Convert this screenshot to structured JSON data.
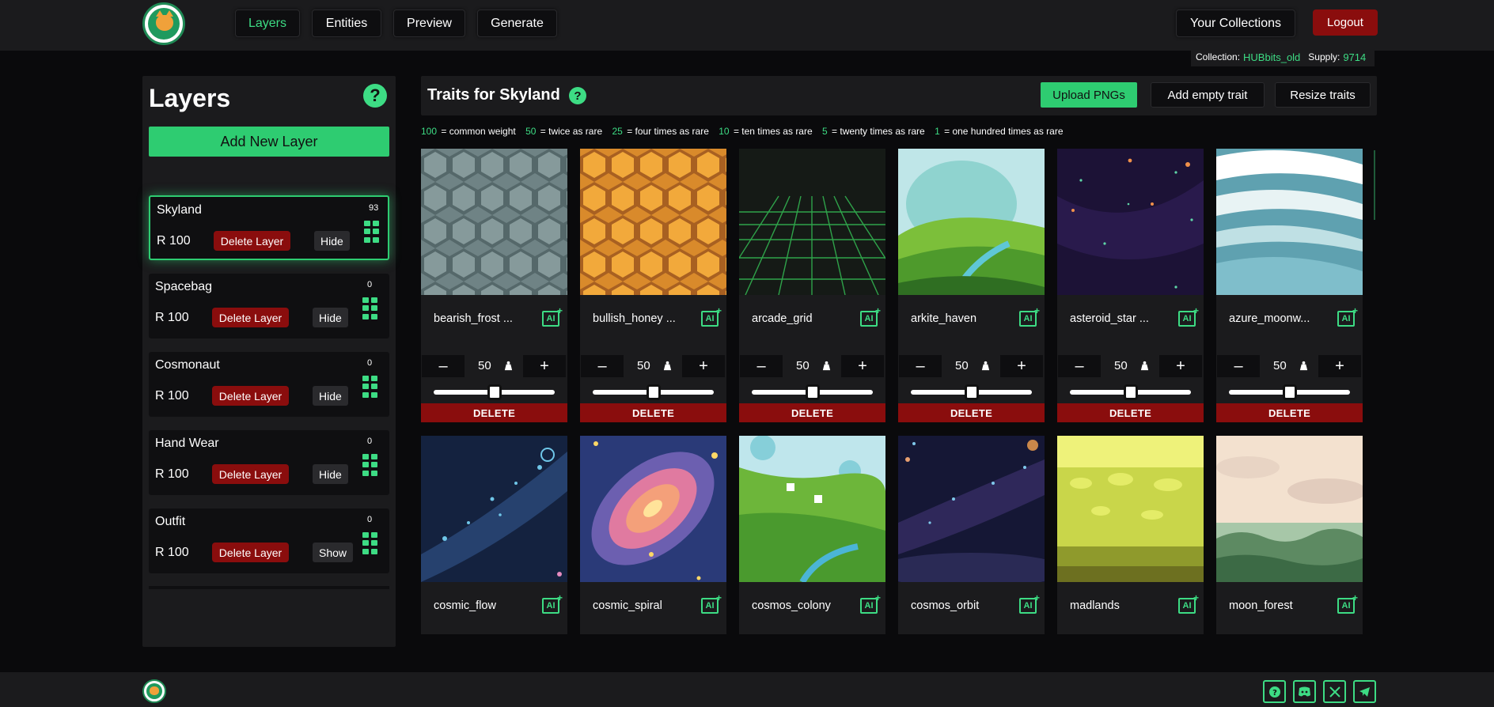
{
  "nav": {
    "tabs": [
      {
        "label": "Layers",
        "active": true
      },
      {
        "label": "Entities"
      },
      {
        "label": "Preview"
      },
      {
        "label": "Generate"
      }
    ],
    "collections_label": "Your Collections",
    "logout_label": "Logout"
  },
  "collection": {
    "collection_label": "Collection:",
    "collection_name": "HUBbits_old",
    "supply_label": "Supply:",
    "supply_value": "9714"
  },
  "layers": {
    "title": "Layers",
    "help_icon": "?",
    "add_label": "Add New Layer",
    "items": [
      {
        "name": "Skyland",
        "rarity": "R 100",
        "count": "93",
        "delete_label": "Delete Layer",
        "visibility_label": "Hide",
        "selected": true
      },
      {
        "name": "Spacebag",
        "rarity": "R 100",
        "count": "0",
        "delete_label": "Delete Layer",
        "visibility_label": "Hide"
      },
      {
        "name": "Cosmonaut",
        "rarity": "R 100",
        "count": "0",
        "delete_label": "Delete Layer",
        "visibility_label": "Hide"
      },
      {
        "name": "Hand Wear",
        "rarity": "R 100",
        "count": "0",
        "delete_label": "Delete Layer",
        "visibility_label": "Hide"
      },
      {
        "name": "Outfit",
        "rarity": "R 100",
        "count": "0",
        "delete_label": "Delete Layer",
        "visibility_label": "Show"
      }
    ]
  },
  "traits": {
    "title": "Traits for Skyland",
    "help_icon": "?",
    "upload_label": "Upload PNGs",
    "add_empty_label": "Add empty trait",
    "resize_label": "Resize traits",
    "legend": [
      {
        "num": "100",
        "text": " = common weight"
      },
      {
        "num": "50",
        "text": " = twice as rare"
      },
      {
        "num": "25",
        "text": " = four times as rare"
      },
      {
        "num": "10",
        "text": " = ten times as rare"
      },
      {
        "num": "5",
        "text": " = twenty times as rare"
      },
      {
        "num": "1",
        "text": " = one hundred times as rare"
      }
    ],
    "items": [
      {
        "name": "bearish_frost ...",
        "weight": "50",
        "slider": 0.5,
        "delete_label": "DELETE"
      },
      {
        "name": "bullish_honey ...",
        "weight": "50",
        "slider": 0.5,
        "delete_label": "DELETE"
      },
      {
        "name": "arcade_grid",
        "weight": "50",
        "slider": 0.5,
        "delete_label": "DELETE"
      },
      {
        "name": "arkite_haven",
        "weight": "50",
        "slider": 0.5,
        "delete_label": "DELETE"
      },
      {
        "name": "asteroid_star ...",
        "weight": "50",
        "slider": 0.5,
        "delete_label": "DELETE"
      },
      {
        "name": "azure_moonw...",
        "weight": "50",
        "slider": 0.5,
        "delete_label": "DELETE"
      },
      {
        "name": "cosmic_flow"
      },
      {
        "name": "cosmic_spiral"
      },
      {
        "name": "cosmos_colony"
      },
      {
        "name": "cosmos_orbit"
      },
      {
        "name": "madlands"
      },
      {
        "name": "moon_forest"
      }
    ],
    "ai_icon_text": "AI",
    "minus_label": "–",
    "plus_label": "+"
  },
  "footer": {
    "icons": [
      "help-icon",
      "discord-icon",
      "x-icon",
      "telegram-icon"
    ]
  },
  "colors": {
    "accent": "#3ddc84",
    "danger": "#8a0d0d",
    "panel": "#1b1b1d"
  }
}
